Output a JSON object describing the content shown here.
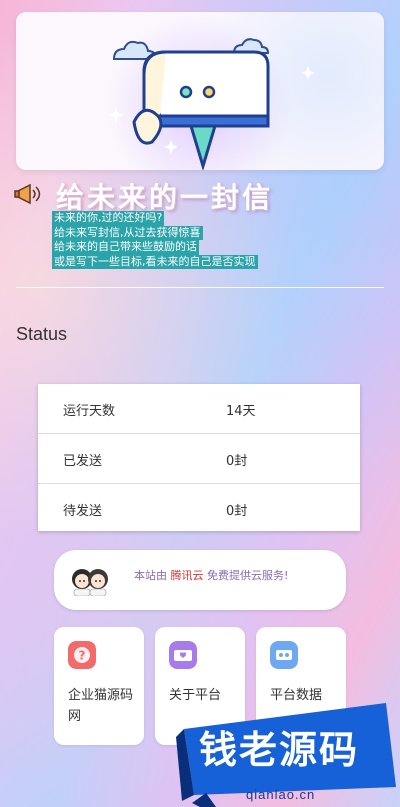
{
  "header": {
    "title": "给未来的一封信",
    "lines": [
      "未来的你,过的还好吗?",
      "给未来写封信,从过去获得惊喜",
      "给未来的自己带来些鼓励的话",
      "或是写下一些目标,看未来的自己是否实现"
    ]
  },
  "status": {
    "heading": "Status",
    "rows": [
      {
        "label": "运行天数",
        "value": "14天"
      },
      {
        "label": "已发送",
        "value": "0封"
      },
      {
        "label": "待发送",
        "value": "0封"
      }
    ]
  },
  "sponsor": {
    "prefix": "本站由",
    "brand": "腾讯云",
    "suffix": "免费提供云服务!"
  },
  "cards": [
    {
      "label": "企业猫源码网",
      "icon": "question-icon",
      "color": "#f26a6a"
    },
    {
      "label": "关于平台",
      "icon": "heart-card-icon",
      "color": "#a77bea"
    },
    {
      "label": "平台数据",
      "icon": "data-icon",
      "color": "#6ea8f0"
    }
  ],
  "watermark": {
    "text": "钱老源码",
    "url": "qianlao.cn"
  }
}
